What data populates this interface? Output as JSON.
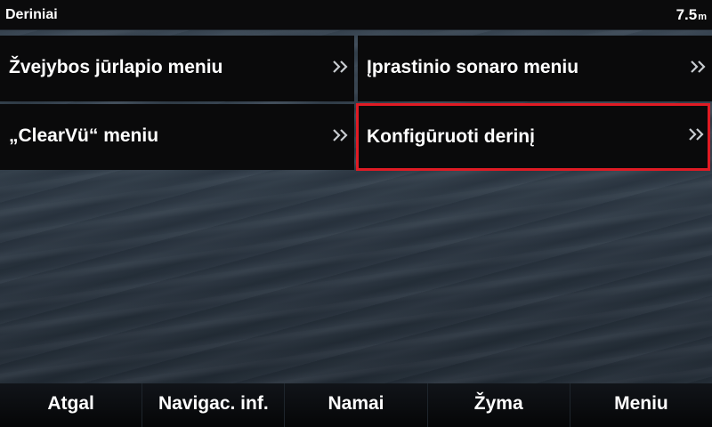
{
  "header": {
    "title": "Deriniai",
    "depth_value": "7.5",
    "depth_unit": "m"
  },
  "menu": {
    "items": [
      {
        "label": "Žvejybos jūrlapio meniu",
        "icon": "double-chevron-right-icon"
      },
      {
        "label": "Įprastinio sonaro meniu",
        "icon": "double-chevron-right-icon"
      },
      {
        "label": "„ClearVü“ meniu",
        "icon": "double-chevron-right-icon"
      },
      {
        "label": "Konfigūruoti derinį",
        "icon": "double-chevron-right-icon",
        "selected": true
      }
    ]
  },
  "footer": {
    "buttons": [
      {
        "label": "Atgal"
      },
      {
        "label": "Navigac. inf."
      },
      {
        "label": "Namai"
      },
      {
        "label": "Žyma"
      },
      {
        "label": "Meniu"
      }
    ]
  },
  "colors": {
    "selection_outline": "#e01b24",
    "tile_background": "#0a0a0b",
    "text": "#ffffff"
  }
}
